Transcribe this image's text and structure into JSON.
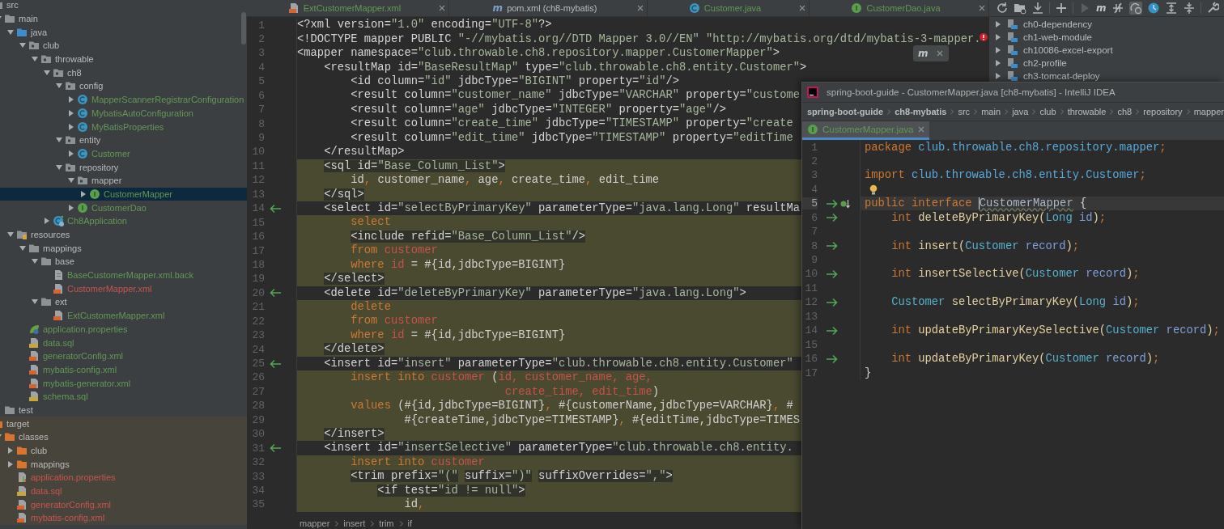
{
  "tree": [
    {
      "label": "src",
      "kind": "folder",
      "color": "#bbbbbb",
      "selected": false,
      "children": [
        {
          "label": "main",
          "kind": "folder",
          "color": "#bbbbbb",
          "expanded": true,
          "selected": false,
          "children": [
            {
              "label": "java",
              "kind": "source-folder",
              "color": "#bbbbbb",
              "expanded": true,
              "selected": false,
              "children": [
                {
                  "label": "club",
                  "kind": "package",
                  "expanded": true,
                  "selected": false,
                  "children": [
                    {
                      "label": "throwable",
                      "kind": "package",
                      "color": "#bbbbbb",
                      "expanded": true,
                      "selected": false,
                      "children": [
                        {
                          "label": "ch8",
                          "kind": "package",
                          "color": "#bbbbbb",
                          "expanded": true,
                          "selected": false,
                          "children": [
                            {
                              "label": "config",
                              "kind": "package",
                              "color": "#bbbbbb",
                              "expanded": true,
                              "selected": false,
                              "children": [
                                {
                                  "label": "MapperScannerRegistrarConfiguration",
                                  "kind": "class",
                                  "color": "#629755",
                                  "expanded": false,
                                  "selected": false
                                },
                                {
                                  "label": "MybatisAutoConfiguration",
                                  "kind": "class",
                                  "color": "#629755",
                                  "expanded": false,
                                  "selected": false
                                },
                                {
                                  "label": "MyBatisProperties",
                                  "kind": "class",
                                  "color": "#629755",
                                  "expanded": false,
                                  "selected": false
                                }
                              ]
                            },
                            {
                              "label": "entity",
                              "kind": "package",
                              "color": "#bbbbbb",
                              "expanded": true,
                              "selected": false,
                              "children": [
                                {
                                  "label": "Customer",
                                  "kind": "class",
                                  "color": "#629755",
                                  "expanded": false,
                                  "selected": false
                                }
                              ]
                            },
                            {
                              "label": "repository",
                              "kind": "package",
                              "color": "#bbbbbb",
                              "expanded": true,
                              "selected": false,
                              "children": [
                                {
                                  "label": "mapper",
                                  "kind": "package",
                                  "color": "#bbbbbb",
                                  "expanded": true,
                                  "selected": false,
                                  "children": [
                                    {
                                      "label": "CustomerMapper",
                                      "kind": "interface",
                                      "color": "#629755",
                                      "expanded": false,
                                      "selected": true
                                    }
                                  ]
                                },
                                {
                                  "label": "CustomerDao",
                                  "kind": "interface",
                                  "color": "#629755",
                                  "expanded": false,
                                  "selected": false
                                }
                              ]
                            }
                          ]
                        },
                        {
                          "label": "Ch8Application",
                          "kind": "app",
                          "color": "#629755",
                          "expanded": false,
                          "selected": false
                        }
                      ]
                    }
                  ]
                }
              ]
            },
            {
              "label": "resources",
              "kind": "resources",
              "color": "#bbbbbb",
              "expanded": true,
              "selected": false,
              "children": [
                {
                  "label": "mappings",
                  "kind": "folder",
                  "color": "#bbbbbb",
                  "expanded": true,
                  "selected": false,
                  "children": [
                    {
                      "label": "base",
                      "kind": "folder",
                      "color": "#bbbbbb",
                      "expanded": true,
                      "selected": false,
                      "children": [
                        {
                          "label": "BaseCustomerMapper.xml.back",
                          "kind": "file",
                          "color": "#629755",
                          "selected": false
                        },
                        {
                          "label": "CustomerMapper.xml",
                          "kind": "xml",
                          "color": "#c75450",
                          "selected": false
                        }
                      ]
                    },
                    {
                      "label": "ext",
                      "kind": "folder",
                      "color": "#bbbbbb",
                      "expanded": true,
                      "selected": false,
                      "children": [
                        {
                          "label": "ExtCustomerMapper.xml",
                          "kind": "xml",
                          "color": "#629755",
                          "selected": false
                        }
                      ]
                    }
                  ]
                },
                {
                  "label": "application.properties",
                  "kind": "spring",
                  "color": "#629755",
                  "selected": false
                },
                {
                  "label": "data.sql",
                  "kind": "sql",
                  "color": "#629755",
                  "selected": false
                },
                {
                  "label": "generatorConfig.xml",
                  "kind": "xml",
                  "color": "#629755",
                  "selected": false
                },
                {
                  "label": "mybatis-config.xml",
                  "kind": "xml",
                  "color": "#629755",
                  "selected": false
                },
                {
                  "label": "mybatis-generator.xml",
                  "kind": "xml",
                  "color": "#629755",
                  "selected": false
                },
                {
                  "label": "schema.sql",
                  "kind": "sql",
                  "color": "#629755",
                  "selected": false
                }
              ]
            }
          ]
        },
        {
          "label": "test",
          "kind": "folder",
          "color": "#bbbbbb",
          "selected": false
        }
      ]
    },
    {
      "label": "target",
      "kind": "excluded-folder",
      "color": "#bbbbbb",
      "excluded": true,
      "selected": false,
      "children": [
        {
          "label": "classes",
          "kind": "excluded-folder",
          "color": "#bbbbbb",
          "expanded": true,
          "selected": false,
          "children": [
            {
              "label": "club",
              "kind": "excluded-folder",
              "expanded": false,
              "selected": false
            },
            {
              "label": "mappings",
              "kind": "excluded-folder",
              "color": "#bbbbbb",
              "expanded": false,
              "selected": false
            },
            {
              "label": "application.properties",
              "kind": "properties",
              "color": "#c75450",
              "selected": false
            },
            {
              "label": "data.sql",
              "kind": "sql",
              "color": "#c75450",
              "selected": false
            },
            {
              "label": "generatorConfig.xml",
              "kind": "xml",
              "color": "#c75450",
              "selected": false
            },
            {
              "label": "mybatis-config.xml",
              "kind": "xml",
              "color": "#c75450",
              "selected": false
            }
          ]
        }
      ]
    }
  ],
  "editor": {
    "tabs": [
      {
        "label": "ExtCustomerMapper.xml",
        "kind": "xml",
        "color": "#629755",
        "selected": false
      },
      {
        "label": "pom.xml (ch8-mybatis)",
        "kind": "maven",
        "glyph": "m",
        "color": "#bbbbbb",
        "selected": false
      },
      {
        "label": "Customer.java",
        "kind": "class",
        "color": "#629755",
        "selected": false
      },
      {
        "label": "CustomerDao.java",
        "kind": "interface",
        "color": "#629755",
        "selected": false
      }
    ],
    "popup": {
      "glyph": "m"
    },
    "lines": [
      {
        "n": "1",
        "shaded": false,
        "navigate": false,
        "tokens": [
          {
            "kind": "markup",
            "text": "<?xml version="
          },
          {
            "kind": "value",
            "text": "\"1.0\""
          },
          {
            "kind": "markup",
            "text": " encoding="
          },
          {
            "kind": "value",
            "text": "\"UTF-8\""
          },
          {
            "kind": "markup",
            "text": "?>"
          }
        ]
      },
      {
        "n": "2",
        "shaded": false,
        "navigate": false,
        "tokens": [
          {
            "kind": "markup",
            "text": "<!DOCTYPE mapper PUBLIC "
          },
          {
            "kind": "value",
            "text": "\"-//mybatis.org//DTD Mapper 3.0//EN\""
          },
          {
            "kind": "value",
            "text": " \"http://mybatis.org/dtd/mybatis-3-mapper."
          }
        ]
      },
      {
        "n": "3",
        "shaded": false,
        "navigate": false,
        "tokens": [
          {
            "kind": "markup",
            "text": "<mapper namespace="
          },
          {
            "kind": "value",
            "text": "\"club.throwable.ch8.repository.mapper.CustomerMapper\""
          },
          {
            "kind": "markup",
            "text": ">"
          }
        ]
      },
      {
        "n": "4",
        "shaded": false,
        "navigate": false,
        "tokens": [
          {
            "kind": "markup",
            "text": "    <resultMap id="
          },
          {
            "kind": "value",
            "text": "\"BaseResultMap\""
          },
          {
            "kind": "markup",
            "text": " type="
          },
          {
            "kind": "value",
            "text": "\"club.throwable.ch8.entity.Customer\""
          },
          {
            "kind": "markup",
            "text": ">"
          }
        ]
      },
      {
        "n": "5",
        "shaded": false,
        "navigate": false,
        "tokens": [
          {
            "kind": "markup",
            "text": "        <id column="
          },
          {
            "kind": "value",
            "text": "\"id\""
          },
          {
            "kind": "markup",
            "text": " jdbcType="
          },
          {
            "kind": "value",
            "text": "\"BIGINT\""
          },
          {
            "kind": "markup",
            "text": " property="
          },
          {
            "kind": "value",
            "text": "\"id\""
          },
          {
            "kind": "markup",
            "text": "/>"
          }
        ]
      },
      {
        "n": "6",
        "shaded": false,
        "navigate": false,
        "tokens": [
          {
            "kind": "markup",
            "text": "        <result column="
          },
          {
            "kind": "value",
            "text": "\"customer_name\""
          },
          {
            "kind": "markup",
            "text": " jdbcType="
          },
          {
            "kind": "value",
            "text": "\"VARCHAR\""
          },
          {
            "kind": "markup",
            "text": " property="
          },
          {
            "kind": "value",
            "text": "\"custome"
          }
        ]
      },
      {
        "n": "7",
        "shaded": false,
        "navigate": false,
        "tokens": [
          {
            "kind": "markup",
            "text": "        <result column="
          },
          {
            "kind": "value",
            "text": "\"age\""
          },
          {
            "kind": "markup",
            "text": " jdbcType="
          },
          {
            "kind": "value",
            "text": "\"INTEGER\""
          },
          {
            "kind": "markup",
            "text": " property="
          },
          {
            "kind": "value",
            "text": "\"age\""
          },
          {
            "kind": "markup",
            "text": "/>"
          }
        ]
      },
      {
        "n": "8",
        "shaded": false,
        "navigate": false,
        "tokens": [
          {
            "kind": "markup",
            "text": "        <result column="
          },
          {
            "kind": "value",
            "text": "\"create_time\""
          },
          {
            "kind": "markup",
            "text": " jdbcType="
          },
          {
            "kind": "value",
            "text": "\"TIMESTAMP\""
          },
          {
            "kind": "markup",
            "text": " property="
          },
          {
            "kind": "value",
            "text": "\"create"
          }
        ]
      },
      {
        "n": "9",
        "shaded": false,
        "navigate": false,
        "tokens": [
          {
            "kind": "markup",
            "text": "        <result column="
          },
          {
            "kind": "value",
            "text": "\"edit_time\""
          },
          {
            "kind": "markup",
            "text": " jdbcType="
          },
          {
            "kind": "value",
            "text": "\"TIMESTAMP\""
          },
          {
            "kind": "markup",
            "text": " property="
          },
          {
            "kind": "value",
            "text": "\"editTime"
          }
        ]
      },
      {
        "n": "10",
        "shaded": false,
        "navigate": false,
        "tokens": [
          {
            "kind": "markup",
            "text": "    </resultMap>"
          }
        ]
      },
      {
        "n": "11",
        "shaded": true,
        "navigate": false,
        "tokens": [
          {
            "kind": "markup",
            "text": "    <sql id="
          },
          {
            "kind": "value",
            "text": "\"Base_Column_List\""
          },
          {
            "kind": "markup",
            "text": ">"
          }
        ]
      },
      {
        "n": "12",
        "shaded": true,
        "navigate": false,
        "tokens": [
          {
            "kind": "plain",
            "text": "        id"
          },
          {
            "kind": "comma",
            "text": ","
          },
          {
            "kind": "plain",
            "text": " customer_name"
          },
          {
            "kind": "comma",
            "text": ","
          },
          {
            "kind": "plain",
            "text": " age"
          },
          {
            "kind": "comma",
            "text": ","
          },
          {
            "kind": "plain",
            "text": " create_time"
          },
          {
            "kind": "comma",
            "text": ","
          },
          {
            "kind": "plain",
            "text": " edit_time"
          }
        ]
      },
      {
        "n": "13",
        "shaded": true,
        "navigate": false,
        "tokens": [
          {
            "kind": "markup",
            "text": "    </sql>"
          }
        ]
      },
      {
        "n": "14",
        "shaded": false,
        "navigate": true,
        "tokens": [
          {
            "kind": "markup",
            "text": "    <select id="
          },
          {
            "kind": "value",
            "text": "\"selectByPrimaryKey\""
          },
          {
            "kind": "markup",
            "text": " parameterType="
          },
          {
            "kind": "value",
            "text": "\"java.lang.Long\""
          },
          {
            "kind": "markup",
            "text": " resultMa"
          }
        ]
      },
      {
        "n": "15",
        "shaded": true,
        "navigate": false,
        "tokens": [
          {
            "kind": "keyword",
            "text": "        select"
          }
        ]
      },
      {
        "n": "16",
        "shaded": true,
        "navigate": false,
        "tokens": [
          {
            "kind": "markup",
            "text": "        <include refid="
          },
          {
            "kind": "value",
            "text": "\"Base_Column_List\""
          },
          {
            "kind": "markup",
            "text": "/>"
          }
        ]
      },
      {
        "n": "17",
        "shaded": true,
        "navigate": false,
        "tokens": [
          {
            "kind": "keyword",
            "text": "        from"
          },
          {
            "kind": "ref",
            "text": " customer"
          }
        ]
      },
      {
        "n": "18",
        "shaded": true,
        "navigate": false,
        "tokens": [
          {
            "kind": "keyword",
            "text": "        where"
          },
          {
            "kind": "ref",
            "text": " id"
          },
          {
            "kind": "plain",
            "text": " = #{id,jdbcType=BIGINT}"
          }
        ]
      },
      {
        "n": "19",
        "shaded": true,
        "navigate": false,
        "tokens": [
          {
            "kind": "markup",
            "text": "    </select>"
          }
        ]
      },
      {
        "n": "20",
        "shaded": false,
        "navigate": true,
        "tokens": [
          {
            "kind": "markup",
            "text": "    <delete id="
          },
          {
            "kind": "value",
            "text": "\"deleteByPrimaryKey\""
          },
          {
            "kind": "markup",
            "text": " parameterType="
          },
          {
            "kind": "value",
            "text": "\"java.lang.Long\""
          },
          {
            "kind": "markup",
            "text": ">"
          }
        ]
      },
      {
        "n": "21",
        "shaded": true,
        "navigate": false,
        "tokens": [
          {
            "kind": "keyword",
            "text": "        delete"
          }
        ]
      },
      {
        "n": "22",
        "shaded": true,
        "navigate": false,
        "tokens": [
          {
            "kind": "keyword",
            "text": "        from"
          },
          {
            "kind": "ref",
            "text": " customer"
          }
        ]
      },
      {
        "n": "23",
        "shaded": true,
        "navigate": false,
        "tokens": [
          {
            "kind": "keyword",
            "text": "        where"
          },
          {
            "kind": "ref",
            "text": " id"
          },
          {
            "kind": "plain",
            "text": " = #{id,jdbcType=BIGINT}"
          }
        ]
      },
      {
        "n": "24",
        "shaded": true,
        "navigate": false,
        "tokens": [
          {
            "kind": "markup",
            "text": "    </delete>"
          }
        ]
      },
      {
        "n": "25",
        "shaded": false,
        "navigate": true,
        "tokens": [
          {
            "kind": "markup",
            "text": "    <insert id="
          },
          {
            "kind": "value",
            "text": "\"insert\""
          },
          {
            "kind": "markup",
            "text": " parameterType="
          },
          {
            "kind": "value",
            "text": "\"club.throwable.ch8.entity.Customer\""
          }
        ]
      },
      {
        "n": "26",
        "shaded": true,
        "navigate": false,
        "tokens": [
          {
            "kind": "keyword",
            "text": "        insert into"
          },
          {
            "kind": "ref",
            "text": " customer"
          },
          {
            "kind": "plain",
            "text": " ("
          },
          {
            "kind": "ref",
            "text": "id, customer_name, age,"
          }
        ]
      },
      {
        "n": "27",
        "shaded": true,
        "navigate": false,
        "tokens": [
          {
            "kind": "ref",
            "text": "                               create_time, edit_time"
          },
          {
            "kind": "plain",
            "text": ")"
          }
        ]
      },
      {
        "n": "28",
        "shaded": true,
        "navigate": false,
        "tokens": [
          {
            "kind": "keyword",
            "text": "        values"
          },
          {
            "kind": "plain",
            "text": " (#{id,jdbcType=BIGINT}"
          },
          {
            "kind": "comma",
            "text": ","
          },
          {
            "kind": "plain",
            "text": " #{customerName,jdbcType=VARCHAR}"
          },
          {
            "kind": "comma",
            "text": ","
          },
          {
            "kind": "plain",
            "text": " #"
          }
        ]
      },
      {
        "n": "29",
        "shaded": true,
        "navigate": false,
        "tokens": [
          {
            "kind": "plain",
            "text": "                #{createTime,jdbcType=TIMESTAMP}"
          },
          {
            "kind": "comma",
            "text": ","
          },
          {
            "kind": "plain",
            "text": " #{editTime,jdbcType=TIMES"
          }
        ]
      },
      {
        "n": "30",
        "shaded": true,
        "navigate": false,
        "tokens": [
          {
            "kind": "markup",
            "text": "    </insert>"
          }
        ]
      },
      {
        "n": "31",
        "shaded": false,
        "navigate": true,
        "tokens": [
          {
            "kind": "markup",
            "text": "    <insert id="
          },
          {
            "kind": "value",
            "text": "\"insertSelective\""
          },
          {
            "kind": "markup",
            "text": " parameterType="
          },
          {
            "kind": "value",
            "text": "\"club.throwable.ch8.entity."
          }
        ]
      },
      {
        "n": "32",
        "shaded": true,
        "navigate": false,
        "tokens": [
          {
            "kind": "keyword",
            "text": "        insert into"
          },
          {
            "kind": "ref",
            "text": " customer"
          }
        ]
      },
      {
        "n": "33",
        "shaded": true,
        "navigate": false,
        "tokens": [
          {
            "kind": "markup",
            "text": "        <trim prefix="
          },
          {
            "kind": "value",
            "text": "\"(\""
          },
          {
            "kind": "markup",
            "text": " suffix="
          },
          {
            "kind": "value",
            "text": "\")\""
          },
          {
            "kind": "markup",
            "text": " suffixOverrides="
          },
          {
            "kind": "value",
            "text": "\",\""
          },
          {
            "kind": "markup",
            "text": ">"
          }
        ]
      },
      {
        "n": "34",
        "shaded": true,
        "navigate": false,
        "tokens": [
          {
            "kind": "markup",
            "text": "            <if test="
          },
          {
            "kind": "value",
            "text": "\"id != null\""
          },
          {
            "kind": "markup",
            "text": ">"
          }
        ]
      },
      {
        "n": "35",
        "shaded": true,
        "navigate": false,
        "tokens": [
          {
            "kind": "plain",
            "text": "                id"
          },
          {
            "kind": "comma",
            "text": ","
          }
        ]
      }
    ],
    "breadcrumbs": [
      "mapper",
      "insert",
      "trim",
      "if"
    ]
  },
  "maven": {
    "glyph": "m",
    "offline_pressed": true,
    "projects": [
      {
        "label": "ch0-dependency",
        "expanded": false
      },
      {
        "label": "ch1-web-module",
        "expanded": false
      },
      {
        "label": "ch10086-excel-export",
        "expanded": false
      },
      {
        "label": "ch2-profile",
        "expanded": false
      },
      {
        "label": "ch3-tomcat-deploy",
        "expanded": false
      }
    ]
  },
  "window": {
    "title": "spring-boot-guide - CustomerMapper.java [ch8-mybatis] - IntelliJ IDEA",
    "path": [
      {
        "label": "spring-boot-guide",
        "kind": "project"
      },
      {
        "label": "ch8-mybatis",
        "kind": "module"
      },
      {
        "label": "src",
        "kind": "dir"
      },
      {
        "label": "main",
        "kind": "dir"
      },
      {
        "label": "java",
        "kind": "dir"
      },
      {
        "label": "club",
        "kind": "dir"
      },
      {
        "label": "throwable",
        "kind": "dir"
      },
      {
        "label": "ch8",
        "kind": "dir"
      },
      {
        "label": "repository",
        "kind": "dir"
      },
      {
        "label": "mapper",
        "kind": "dir"
      }
    ],
    "tab": {
      "label": "CustomerMapper.java",
      "kind": "interface",
      "color": "#629755",
      "selected": true
    },
    "lines": [
      {
        "n": "1",
        "navigate": false,
        "implemented": false,
        "bulb": false,
        "current": false,
        "tokens": [
          {
            "kind": "keyword",
            "text": "package"
          },
          {
            "kind": "package",
            "text": " club.throwable.ch8.repository.mapper"
          },
          {
            "kind": "keyword",
            "text": ";"
          }
        ]
      },
      {
        "n": "2",
        "navigate": false,
        "implemented": false,
        "bulb": false,
        "current": false
      },
      {
        "n": "3",
        "navigate": false,
        "implemented": false,
        "bulb": false,
        "current": false,
        "tokens": [
          {
            "kind": "keyword",
            "text": "import"
          },
          {
            "kind": "package",
            "text": " club.throwable.ch8.entity.Customer"
          },
          {
            "kind": "keyword",
            "text": ";"
          }
        ]
      },
      {
        "n": "4",
        "navigate": false,
        "implemented": false,
        "bulb": true,
        "current": false
      },
      {
        "n": "5",
        "navigate": true,
        "implemented": true,
        "bulb": false,
        "current": true,
        "tokens": [
          {
            "kind": "keyword",
            "text": "public interface "
          },
          {
            "kind": "declaration",
            "text": "CustomerMapper"
          },
          {
            "kind": "plain",
            "text": " {"
          }
        ]
      },
      {
        "n": "6",
        "navigate": true,
        "implemented": false,
        "bulb": false,
        "current": false,
        "tokens": [
          {
            "kind": "keyword",
            "text": "    int "
          },
          {
            "kind": "method",
            "text": "deleteByPrimaryKey("
          },
          {
            "kind": "type",
            "text": "Long"
          },
          {
            "kind": "param",
            "text": " id"
          },
          {
            "kind": "method",
            "text": ")"
          },
          {
            "kind": "keyword",
            "text": ";"
          }
        ]
      },
      {
        "n": "7",
        "navigate": false,
        "implemented": false,
        "bulb": false,
        "current": false
      },
      {
        "n": "8",
        "navigate": true,
        "implemented": false,
        "bulb": false,
        "current": false,
        "tokens": [
          {
            "kind": "keyword",
            "text": "    int "
          },
          {
            "kind": "method",
            "text": "insert("
          },
          {
            "kind": "type",
            "text": "Customer"
          },
          {
            "kind": "param",
            "text": " record"
          },
          {
            "kind": "method",
            "text": ")"
          },
          {
            "kind": "keyword",
            "text": ";"
          }
        ]
      },
      {
        "n": "9",
        "navigate": false,
        "implemented": false,
        "bulb": false,
        "current": false
      },
      {
        "n": "10",
        "navigate": true,
        "implemented": false,
        "bulb": false,
        "current": false,
        "tokens": [
          {
            "kind": "keyword",
            "text": "    int "
          },
          {
            "kind": "method",
            "text": "insertSelective("
          },
          {
            "kind": "type",
            "text": "Customer"
          },
          {
            "kind": "param",
            "text": " record"
          },
          {
            "kind": "method",
            "text": ")"
          },
          {
            "kind": "keyword",
            "text": ";"
          }
        ]
      },
      {
        "n": "11",
        "navigate": false,
        "implemented": false,
        "bulb": false,
        "current": false
      },
      {
        "n": "12",
        "navigate": true,
        "implemented": false,
        "bulb": false,
        "current": false,
        "tokens": [
          {
            "kind": "type",
            "text": "    Customer"
          },
          {
            "kind": "method",
            "text": " selectByPrimaryKey("
          },
          {
            "kind": "type",
            "text": "Long"
          },
          {
            "kind": "param",
            "text": " id"
          },
          {
            "kind": "method",
            "text": ")"
          },
          {
            "kind": "keyword",
            "text": ";"
          }
        ]
      },
      {
        "n": "13",
        "navigate": false,
        "implemented": false,
        "bulb": false,
        "current": false
      },
      {
        "n": "14",
        "navigate": true,
        "implemented": false,
        "bulb": false,
        "current": false,
        "tokens": [
          {
            "kind": "keyword",
            "text": "    int "
          },
          {
            "kind": "method",
            "text": "updateByPrimaryKeySelective("
          },
          {
            "kind": "type",
            "text": "Customer"
          },
          {
            "kind": "param",
            "text": " record"
          },
          {
            "kind": "method",
            "text": ")"
          },
          {
            "kind": "keyword",
            "text": ";"
          }
        ]
      },
      {
        "n": "15",
        "navigate": false,
        "implemented": false,
        "bulb": false,
        "current": false
      },
      {
        "n": "16",
        "navigate": true,
        "implemented": false,
        "bulb": false,
        "current": false,
        "tokens": [
          {
            "kind": "keyword",
            "text": "    int "
          },
          {
            "kind": "method",
            "text": "updateByPrimaryKey("
          },
          {
            "kind": "type",
            "text": "Customer"
          },
          {
            "kind": "param",
            "text": " record"
          },
          {
            "kind": "method",
            "text": ")"
          },
          {
            "kind": "keyword",
            "text": ";"
          }
        ]
      },
      {
        "n": "17",
        "navigate": false,
        "implemented": false,
        "bulb": false,
        "current": false,
        "tokens": [
          {
            "kind": "plain",
            "text": "}"
          }
        ]
      }
    ]
  }
}
